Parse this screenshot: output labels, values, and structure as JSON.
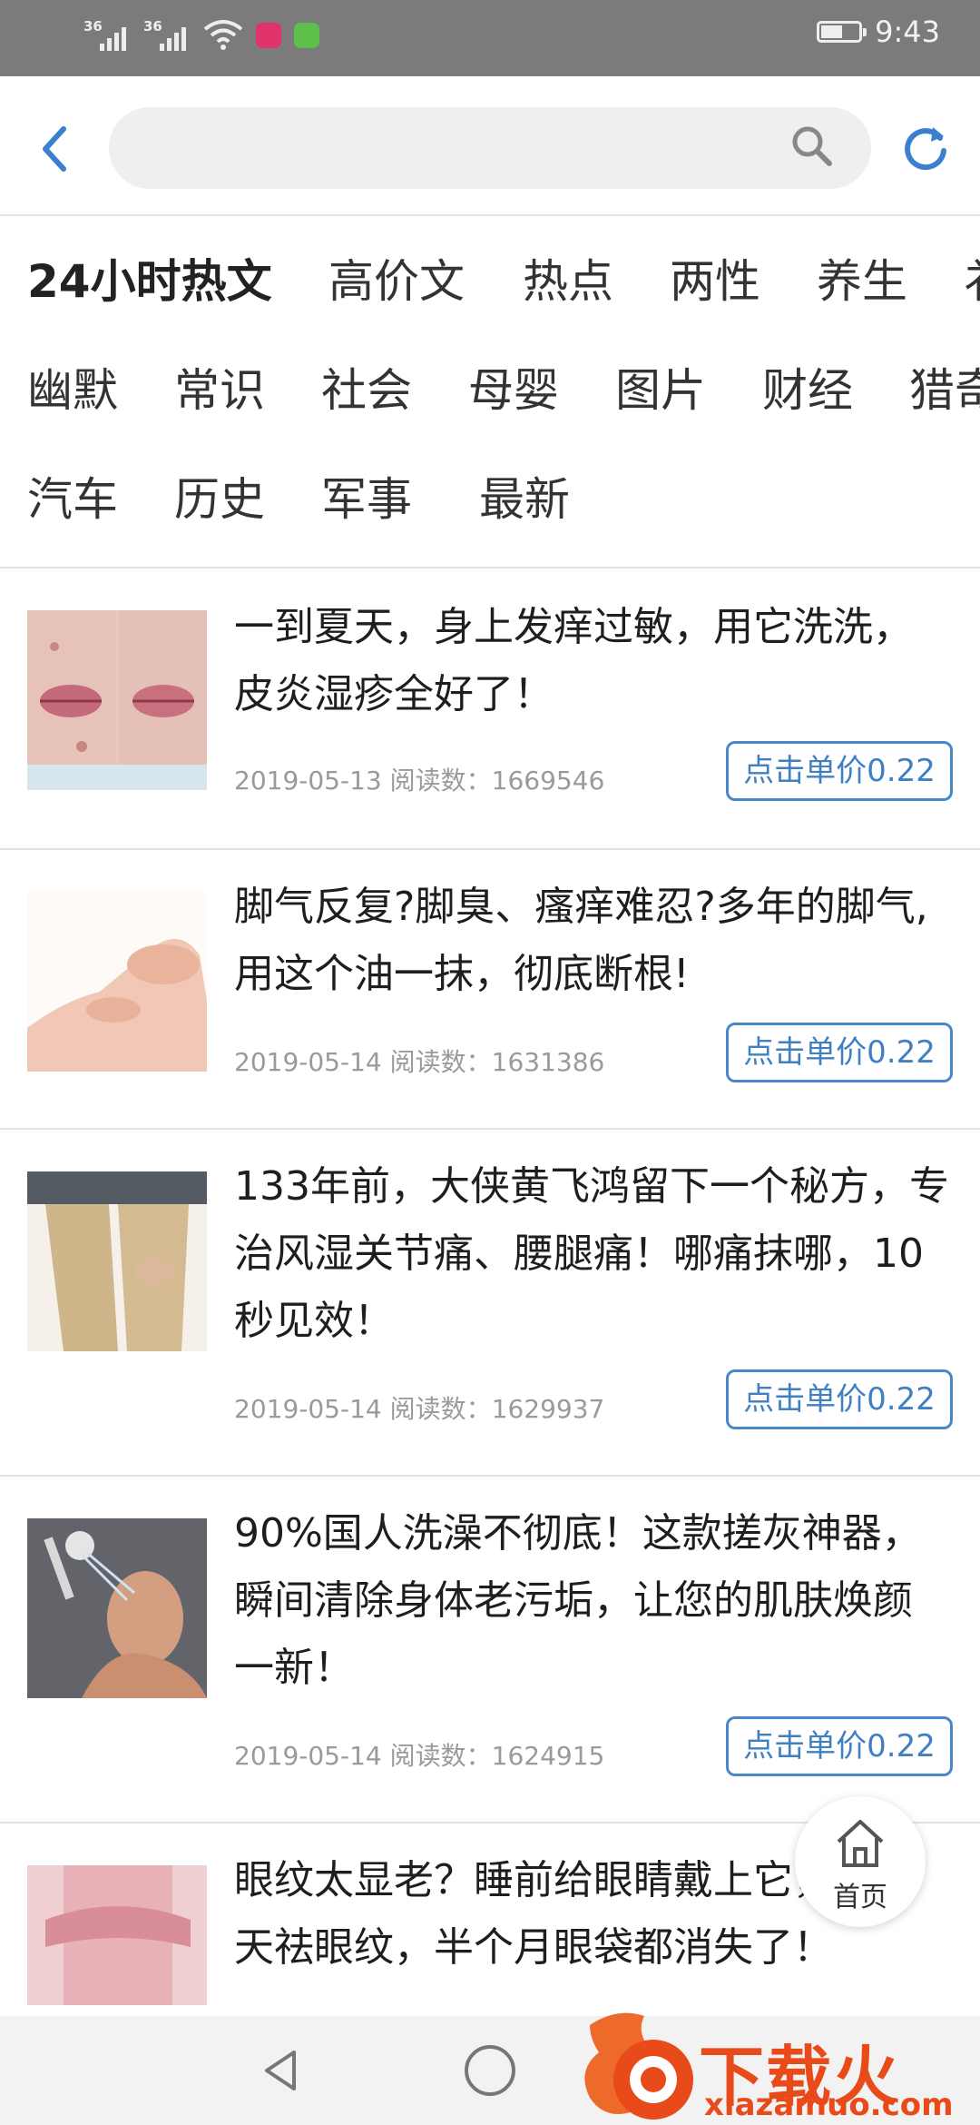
{
  "status_bar": {
    "signal1_label": "36",
    "signal2_label": "36",
    "time": "9:43",
    "battery_level": 0.55
  },
  "search": {
    "placeholder": ""
  },
  "categories": [
    "24小时热文",
    "高价文",
    "热点",
    "两性",
    "养生",
    "衤",
    "幽默",
    "常识",
    "社会",
    "母婴",
    "图片",
    "财经",
    "猎奇",
    "汽车",
    "历史",
    "军事",
    "最新"
  ],
  "articles": [
    {
      "title": "一到夏天，身上发痒过敏，用它洗洗，皮炎湿疹全好了！",
      "date": "2019-05-13",
      "reads_label": "阅读数：",
      "reads": "1669546",
      "price_label": "点击单价0.22"
    },
    {
      "title": "脚气反复?脚臭、瘙痒难忍?多年的脚气,用这个油一抹，彻底断根!",
      "date": "2019-05-14",
      "reads_label": "阅读数：",
      "reads": "1631386",
      "price_label": "点击单价0.22"
    },
    {
      "title": "133年前，大侠黄飞鸿留下一个秘方，专治风湿关节痛、腰腿痛！哪痛抹哪，10秒见效！",
      "date": "2019-05-14",
      "reads_label": "阅读数：",
      "reads": "1629937",
      "price_label": "点击单价0.22"
    },
    {
      "title": "90%国人洗澡不彻底！这款搓灰神器，瞬间清除身体老污垢，让您的肌肤焕颜一新！",
      "date": "2019-05-14",
      "reads_label": "阅读数：",
      "reads": "1624915",
      "price_label": "点击单价0.22"
    },
    {
      "title": "眼纹太显老？睡前给眼睛戴上它，天祛眼纹，半个月眼袋都消失了！",
      "date": "",
      "reads_label": "",
      "reads": "",
      "price_label": ""
    }
  ],
  "fab": {
    "label": "首页"
  },
  "watermark": {
    "text": "下载火",
    "sub": "xiazaihuo.com"
  },
  "colors": {
    "accent": "#3f7fc2",
    "status_bar": "#7b7b7b",
    "watermark": "#e84a1a"
  }
}
